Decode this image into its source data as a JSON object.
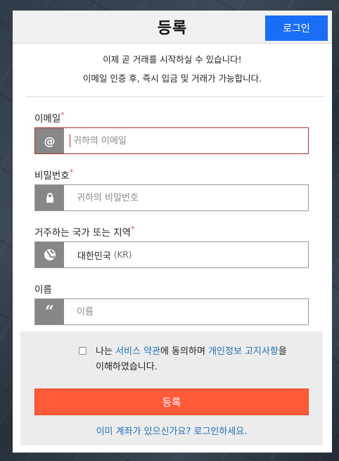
{
  "header": {
    "title": "등록",
    "login_label": "로그인"
  },
  "intro": {
    "line1": "이제 곧 거래를 시작하실 수 있습니다!",
    "line2": "이메일 인증 후, 즉시 입금 및 거래가 가능합니다."
  },
  "fields": {
    "email": {
      "label": "이메일",
      "required_mark": "*",
      "placeholder": "귀하의 이메일",
      "icon": "at-icon"
    },
    "password": {
      "label": "비밀번호",
      "required_mark": "*",
      "placeholder": "귀하의 비밀번호",
      "icon": "lock-icon"
    },
    "country": {
      "label": "거주하는 국가 또는 지역",
      "required_mark": "*",
      "value": "대한민국",
      "code": "(KR)",
      "icon": "globe-icon"
    },
    "name": {
      "label": "이름",
      "placeholder": "이름",
      "icon": "quote-icon"
    }
  },
  "agreement": {
    "prefix": "나는 ",
    "terms_link": "서비스 약관",
    "middle": "에 동의하며 ",
    "privacy_link": "개인정보 고지사항",
    "suffix": "을 이해하였습니다."
  },
  "submit_label": "등록",
  "have_account_label": "이미 계좌가 있으신가요? 로그인하세요.",
  "colors": {
    "login": "#1a6ef5",
    "submit": "#ff5a3a",
    "link": "#1f6fb8",
    "error_border": "#b03030"
  }
}
